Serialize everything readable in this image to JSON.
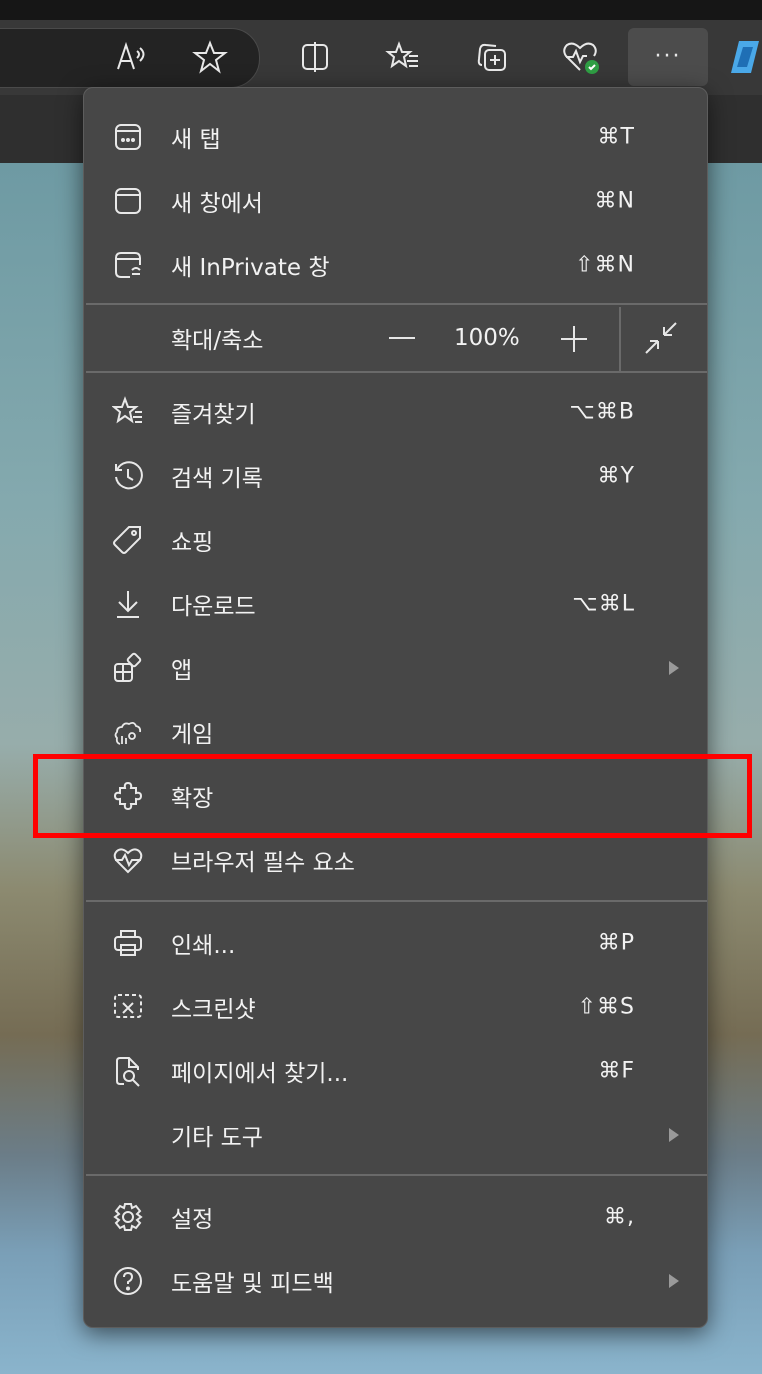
{
  "toolbar": {
    "icons": [
      "read-aloud-icon",
      "favorite-star-icon",
      "split-screen-icon",
      "favorites-icon",
      "collections-icon",
      "browser-essentials-icon",
      "more-icon",
      "copilot-icon"
    ]
  },
  "menu": {
    "new_tab": {
      "label": "새 탭",
      "shortcut": "⌘T"
    },
    "new_window": {
      "label": "새 창에서",
      "shortcut": "⌘N"
    },
    "inprivate": {
      "label": "새 InPrivate 창",
      "shortcut": "⇧⌘N"
    },
    "zoom": {
      "label": "확대/축소",
      "minus": "—",
      "value": "100%",
      "plus": "+"
    },
    "favorites": {
      "label": "즐겨찾기",
      "shortcut": "⌥⌘B"
    },
    "history": {
      "label": "검색 기록",
      "shortcut": "⌘Y"
    },
    "shopping": {
      "label": "쇼핑"
    },
    "downloads": {
      "label": "다운로드",
      "shortcut": "⌥⌘L"
    },
    "apps": {
      "label": "앱"
    },
    "games": {
      "label": "게임"
    },
    "extensions": {
      "label": "확장"
    },
    "essentials": {
      "label": "브라우저 필수 요소"
    },
    "print": {
      "label": "인쇄...",
      "shortcut": "⌘P"
    },
    "screenshot": {
      "label": "스크린샷",
      "shortcut": "⇧⌘S"
    },
    "find": {
      "label": "페이지에서 찾기...",
      "shortcut": "⌘F"
    },
    "more_tools": {
      "label": "기타 도구"
    },
    "settings": {
      "label": "설정",
      "shortcut": "⌘,"
    },
    "help": {
      "label": "도움말 및 피드백"
    }
  },
  "colors": {
    "highlight": "#ff0000",
    "menu_bg": "#474747",
    "text": "#f2f2f2"
  }
}
